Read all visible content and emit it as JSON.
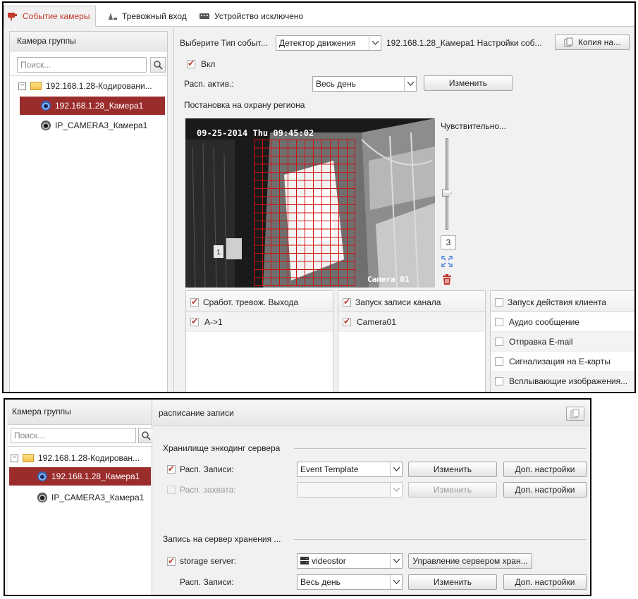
{
  "panel1": {
    "tabs": [
      {
        "label": "Событие камеры",
        "icon": "camera-event-icon",
        "active": true
      },
      {
        "label": "Тревожный вход",
        "icon": "alarm-input-icon",
        "active": false
      },
      {
        "label": "Устройство исключено",
        "icon": "device-offline-icon",
        "active": false
      }
    ],
    "sidebar": {
      "title": "Камера группы",
      "search_placeholder": "Поиск...",
      "tree": [
        {
          "label": "192.168.1.28-Кодировани...",
          "type": "folder"
        },
        {
          "label": "192.168.1.28_Камера1",
          "type": "camera",
          "selected": true
        },
        {
          "label": "IP_CAMERA3_Камера1",
          "type": "camera",
          "selected": false
        }
      ]
    },
    "event": {
      "type_label": "Выберите Тип событ...",
      "type_value": "Детектор движения",
      "camera_settings": "192.168.1.28_Камера1 Настройки соб...",
      "copy_button": "Копия на...",
      "enable_label": "Вкл",
      "enabled": true,
      "schedule_label": "Расп. актив.:",
      "schedule_value": "Весь день",
      "edit_button": "Изменить",
      "region_label": "Постановка на охрану региона",
      "video_timestamp": "09-25-2014 Thu 09:45:02",
      "video_camera_name": "Camera 01",
      "sensitivity_label": "Чувствительно...",
      "sensitivity_value": "3",
      "sensitivity_level_fraction": 0.4
    },
    "lists": {
      "alarm_output": {
        "header": "Сработ. тревож. Выхода",
        "header_checked": true,
        "items": [
          {
            "label": "A->1",
            "checked": true
          }
        ]
      },
      "channel_record": {
        "header": "Запуск записи канала",
        "header_checked": true,
        "items": [
          {
            "label": "Camera01",
            "checked": true
          }
        ]
      },
      "client_action": {
        "header": "Запуск действия клиента",
        "header_checked": false,
        "items": [
          {
            "label": "Аудио сообщение",
            "checked": false
          },
          {
            "label": "Отправка E-mail",
            "checked": false
          },
          {
            "label": "Сигнализация на E-карты",
            "checked": false
          },
          {
            "label": "Всплывающие изображения...",
            "checked": false
          }
        ]
      }
    }
  },
  "panel2": {
    "sidebar": {
      "title": "Камера группы",
      "search_placeholder": "Поиск...",
      "tree": [
        {
          "label": "192.168.1.28-Кодирован...",
          "type": "folder"
        },
        {
          "label": "192.168.1.28_Камера1",
          "type": "camera",
          "selected": true
        },
        {
          "label": "IP_CAMERA3_Камера1",
          "type": "camera",
          "selected": false
        }
      ]
    },
    "header": "расписание записи",
    "storage_section": "Хранилище энкодинг сервера",
    "record_schedule_label": "Расп. Записи:",
    "record_schedule_value": "Event Template",
    "record_schedule_checked": true,
    "capture_schedule_label": "Расп. захвата:",
    "capture_schedule_value": "",
    "capture_schedule_checked": false,
    "edit_button": "Изменить",
    "advanced_button": "Доп. настройки",
    "server_section": "Запись на сервер хранения ...",
    "storage_server_label": "storage server:",
    "storage_server_checked": true,
    "storage_server_value": "videostor",
    "manage_button": "Управление сервером хран...",
    "server_schedule_label": "Расп. Записи:",
    "server_schedule_value": "Весь день"
  }
}
